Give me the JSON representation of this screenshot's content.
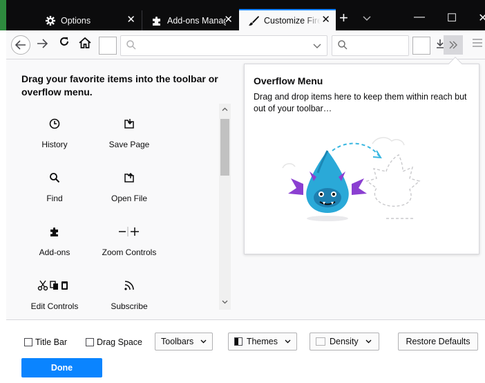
{
  "tabs": [
    {
      "label": "Options",
      "icon": "gear-icon"
    },
    {
      "label": "Add-ons Manager",
      "icon": "puzzle-icon"
    },
    {
      "label": "Customize Firefox",
      "icon": "paintbrush-icon",
      "active": true
    }
  ],
  "tab_close_glyph": "✕",
  "new_tab_glyph": "+",
  "window_controls": {
    "minimize": "—",
    "maximize": "☐",
    "close": "✕"
  },
  "palette": {
    "heading": "Drag your favorite items into the toolbar or overflow menu.",
    "items": [
      {
        "label": "History",
        "icon": "history-icon"
      },
      {
        "label": "Save Page",
        "icon": "save-page-icon"
      },
      {
        "label": "Find",
        "icon": "find-icon"
      },
      {
        "label": "Open File",
        "icon": "open-file-icon"
      },
      {
        "label": "Add-ons",
        "icon": "addons-icon"
      },
      {
        "label": "Zoom Controls",
        "icon": "zoom-controls-icon"
      },
      {
        "label": "Edit Controls",
        "icon": "edit-controls-icon"
      },
      {
        "label": "Subscribe",
        "icon": "subscribe-icon"
      }
    ]
  },
  "overflow_panel": {
    "title": "Overflow Menu",
    "description": "Drag and drop items here to keep them within reach but out of your toolbar…"
  },
  "footer": {
    "title_bar": "Title Bar",
    "drag_space": "Drag Space",
    "toolbars": "Toolbars",
    "themes": "Themes",
    "density": "Density",
    "restore_defaults": "Restore Defaults",
    "done": "Done"
  },
  "colors": {
    "accent": "#0a84ff",
    "tabbar": "#0c0c0d",
    "illustration": "#2aa9d8"
  }
}
